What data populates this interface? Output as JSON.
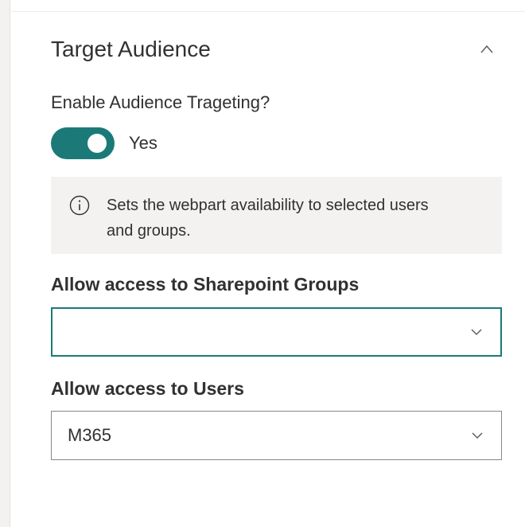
{
  "section": {
    "title": "Target Audience"
  },
  "toggle": {
    "label": "Enable Audience Trageting?",
    "state_text": "Yes",
    "on": true
  },
  "info": {
    "text": "Sets the webpart availability to selected users and groups."
  },
  "groups_field": {
    "label": "Allow access to Sharepoint Groups",
    "value": ""
  },
  "users_field": {
    "label": "Allow access to Users",
    "value": "M365"
  },
  "colors": {
    "accent": "#1b7a78",
    "info_bg": "#f3f2f1"
  },
  "icons": {
    "collapse": "chevron-up-icon",
    "info": "info-icon",
    "dropdown": "chevron-down-icon"
  }
}
